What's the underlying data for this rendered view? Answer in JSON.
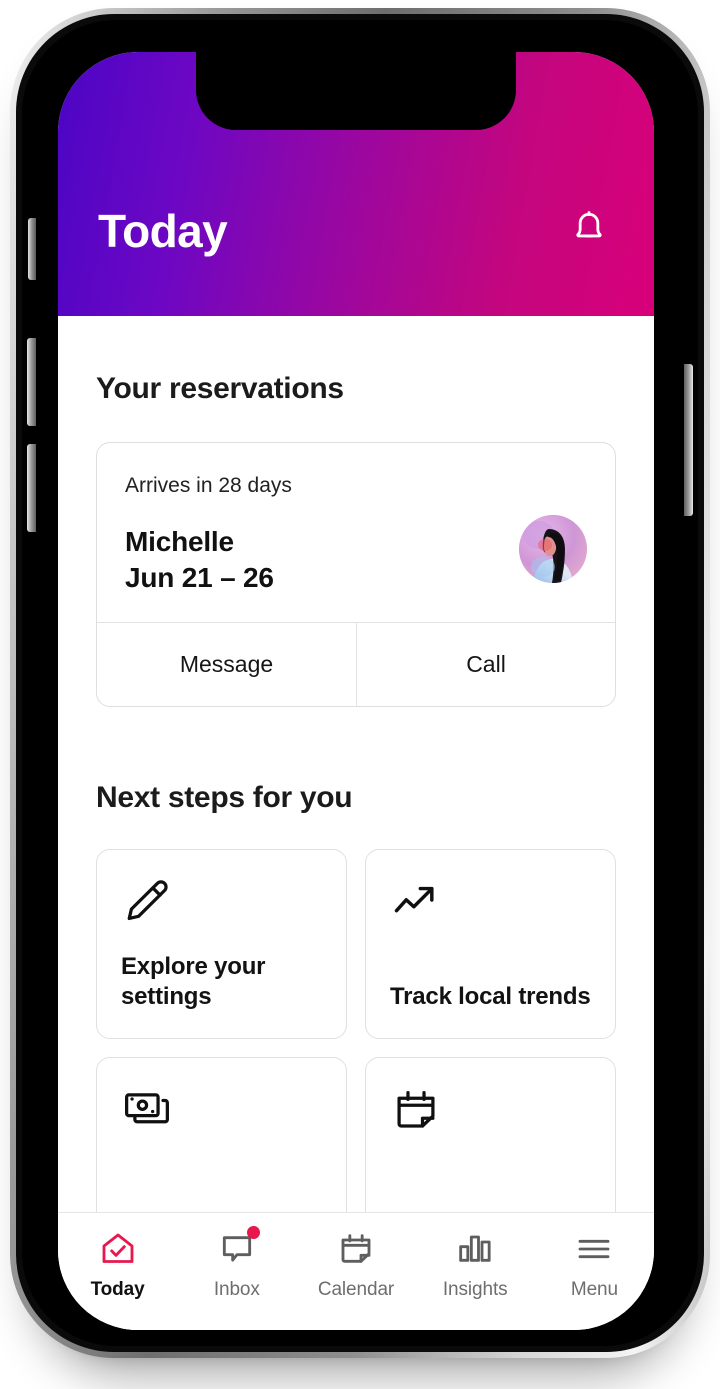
{
  "app": {
    "header": {
      "title": "Today",
      "notification_icon": "bell-icon",
      "gradient_start": "#4b06c4",
      "gradient_end": "#d8007a"
    }
  },
  "reservations": {
    "section_title": "Your reservations",
    "card": {
      "eyebrow": "Arrives in 28 days",
      "guest_name": "Michelle",
      "dates": "Jun 21 – 26",
      "avatar_alt": "guest-avatar",
      "actions": [
        {
          "label": "Message",
          "name": "message-button"
        },
        {
          "label": "Call",
          "name": "call-button"
        }
      ]
    }
  },
  "next_steps": {
    "section_title": "Next steps for you",
    "cards": [
      {
        "label": "Explore your settings",
        "icon": "pencil-icon"
      },
      {
        "label": "Track local trends",
        "icon": "trending-up-icon"
      },
      {
        "label": "",
        "icon": "money-stack-icon"
      },
      {
        "label": "",
        "icon": "calendar-icon"
      }
    ]
  },
  "tabbar": {
    "items": [
      {
        "label": "Today",
        "icon": "home-check-icon",
        "active": true,
        "badge": false
      },
      {
        "label": "Inbox",
        "icon": "speech-bubble-icon",
        "active": false,
        "badge": true
      },
      {
        "label": "Calendar",
        "icon": "calendar-icon",
        "active": false,
        "badge": false
      },
      {
        "label": "Insights",
        "icon": "bar-chart-icon",
        "active": false,
        "badge": false
      },
      {
        "label": "Menu",
        "icon": "hamburger-icon",
        "active": false,
        "badge": false
      }
    ],
    "active_color": "#e8174e",
    "badge_color": "#e8174e"
  }
}
